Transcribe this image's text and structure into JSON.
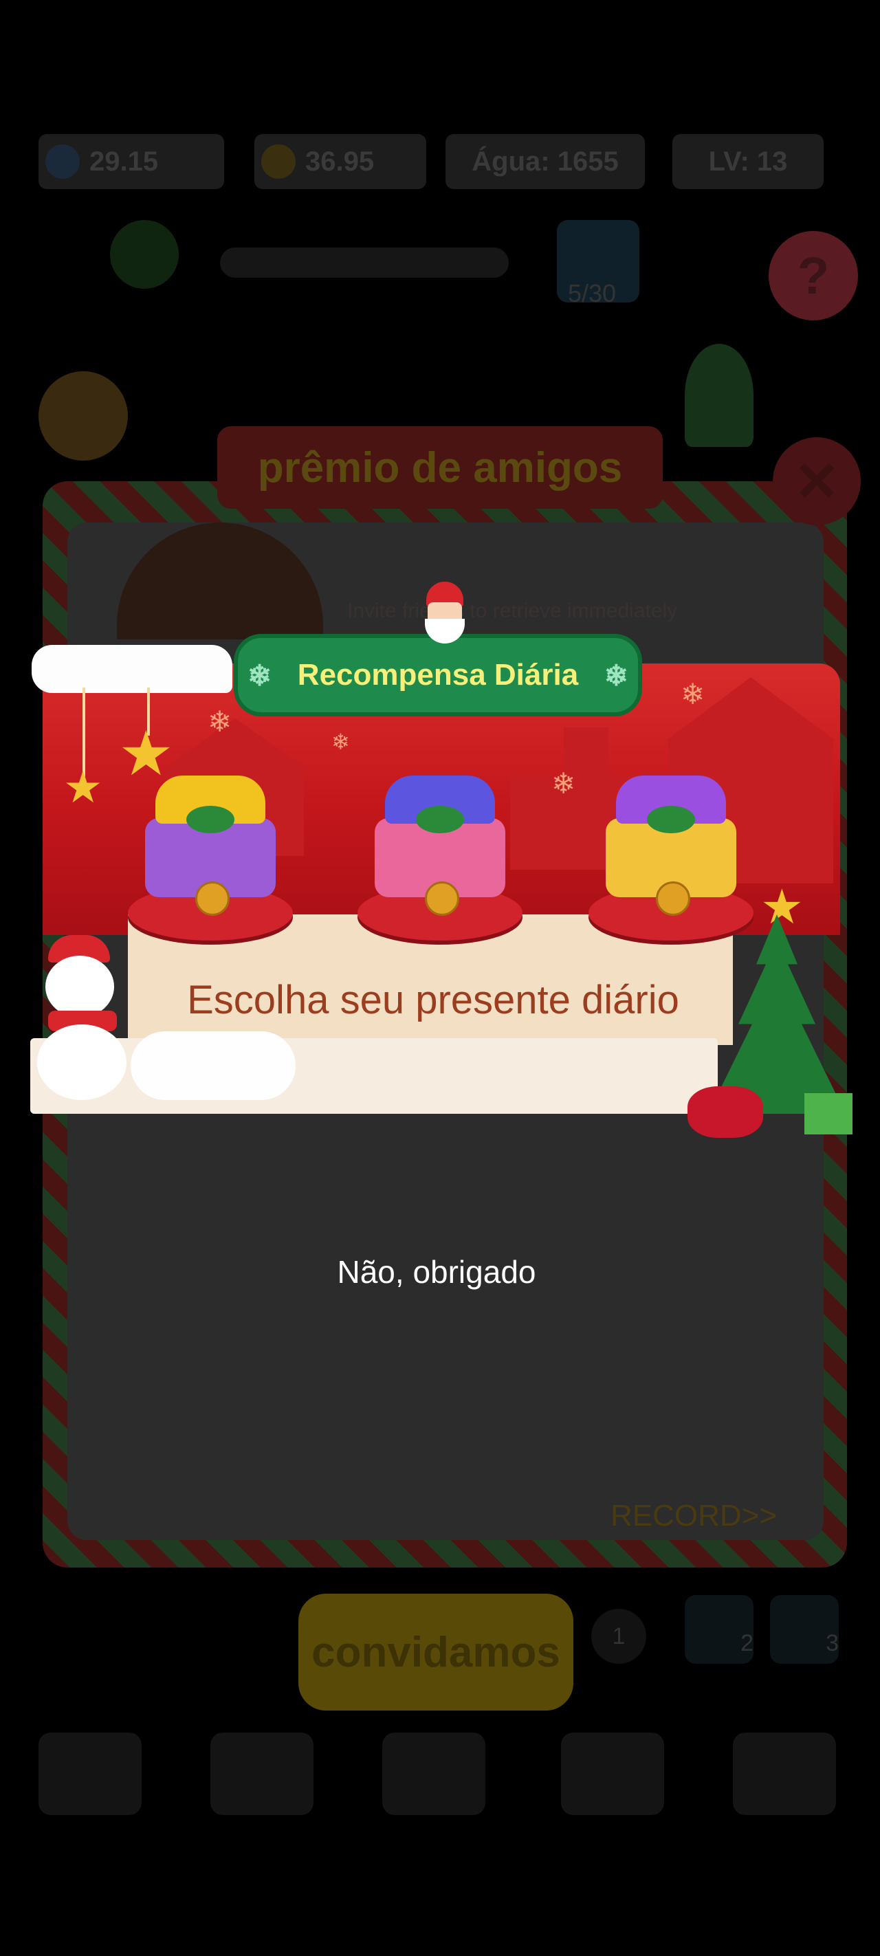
{
  "hud": {
    "gems_value": "29.15",
    "coins_value": "36.95",
    "water_label": "Água: 1655",
    "level_label": "LV: 13",
    "progress_label": "5/30",
    "help_symbol": "?"
  },
  "friends_panel": {
    "title": "prêmio de amigos",
    "invite_hint": "Invite friends to retrieve immediately",
    "record_label": "RECORD>>",
    "invite_button_label": "convidamos",
    "close_symbol": "✕",
    "friend_slots": [
      "1",
      "2",
      "3"
    ]
  },
  "daily_reward": {
    "title": "Recompensa Diária",
    "subtitle": "Escolha seu presente diário",
    "dismiss_label": "Não, obrigado",
    "gifts": [
      {
        "box_color": "#9b5cd6",
        "bow_color": "#f2c21e"
      },
      {
        "box_color": "#e9679a",
        "bow_color": "#5b55e0"
      },
      {
        "box_color": "#f2c33a",
        "bow_color": "#9b4fe0"
      }
    ]
  },
  "colors": {
    "modal_red": "#d82b2b",
    "badge_green": "#1e8a4b",
    "badge_text": "#f6f07a",
    "subtitle_brown": "#9b3d1e"
  }
}
